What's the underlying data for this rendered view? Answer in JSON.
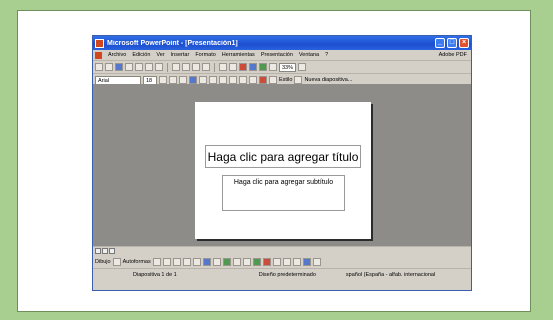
{
  "window": {
    "title": "Microsoft PowerPoint - [Presentación1]"
  },
  "menu": [
    "Archivo",
    "Edición",
    "Ver",
    "Insertar",
    "Formato",
    "Herramientas",
    "Presentación",
    "Ventana",
    "?"
  ],
  "help_box": "Adobe PDF",
  "toolbar": {
    "zoom": "33%"
  },
  "format": {
    "font": "Arial",
    "size": "18",
    "style_label": "Estilo",
    "new_slide_label": "Nueva diapositiva..."
  },
  "slide": {
    "title_placeholder": "Haga clic para agregar título",
    "subtitle_placeholder": "Haga clic para agregar subtítulo"
  },
  "draw": {
    "draw_label": "Dibujo",
    "autoshapes_label": "Autoformas"
  },
  "status": {
    "slide": "Diapositiva 1 de 1",
    "design": "Diseño predeterminado",
    "language": "spañol (España - alfab. internacional"
  }
}
